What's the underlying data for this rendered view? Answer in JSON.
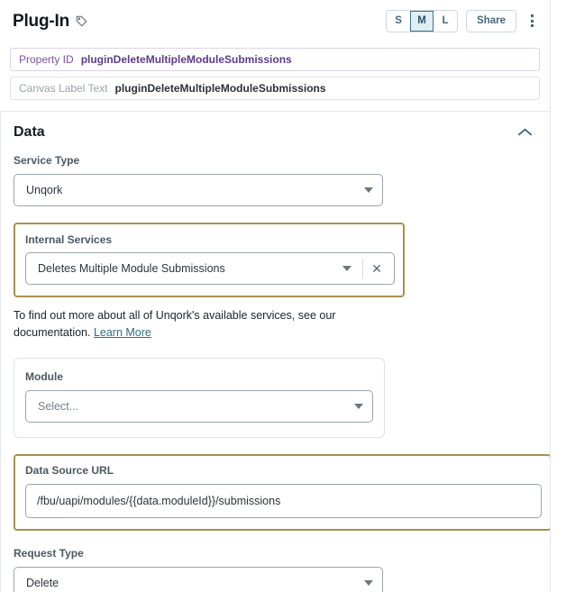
{
  "header": {
    "title": "Plug-In",
    "tag_icon": "tag-icon",
    "size_options": [
      "S",
      "M",
      "L"
    ],
    "size_selected": "M",
    "share_label": "Share",
    "menu_icon": "kebab-menu-icon"
  },
  "identity": {
    "property_id_label": "Property ID",
    "property_id_value": "pluginDeleteMultipleModuleSubmissions",
    "canvas_label_label": "Canvas Label Text",
    "canvas_label_value": "pluginDeleteMultipleModuleSubmissions"
  },
  "data_panel": {
    "title": "Data",
    "collapse_icon": "chevron-up-icon",
    "service_type": {
      "label": "Service Type",
      "value": "Unqork",
      "caret_icon": "chevron-down-icon"
    },
    "internal_services": {
      "label": "Internal Services",
      "value": "Deletes Multiple Module Submissions",
      "caret_icon": "chevron-down-icon",
      "clear_icon": "close-icon"
    },
    "helper": {
      "text": "To find out more about all of Unqork's available services, see our documentation. ",
      "link_label": "Learn More"
    },
    "module": {
      "label": "Module",
      "value": "Select...",
      "caret_icon": "chevron-down-icon"
    },
    "data_source_url": {
      "label": "Data Source URL",
      "value": "/fbu/uapi/modules/{{data.moduleId}}/submissions"
    },
    "request_type": {
      "label": "Request Type",
      "value": "Delete",
      "caret_icon": "chevron-down-icon"
    }
  },
  "colors": {
    "highlight_border": "#a8914f",
    "accent_teal": "#44697c",
    "property_purple": "#5b3b8c",
    "link": "#2f6d80"
  }
}
